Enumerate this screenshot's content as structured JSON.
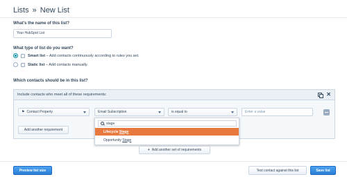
{
  "header": {
    "breadcrumb_root": "Lists",
    "separator": "»",
    "page_title": "New List"
  },
  "name_section": {
    "label": "What's the name of this list?",
    "value": "Your HubSpot List"
  },
  "type_section": {
    "label": "What type of list do you want?",
    "options": [
      {
        "name": "Smart list",
        "description": " – Add contacts continuously according to rules you set.",
        "selected": true
      },
      {
        "name": "Static list",
        "description": " – Add contacts manually.",
        "selected": false
      }
    ]
  },
  "contacts_section": {
    "label": "Which contacts should be in this list?"
  },
  "requirements": {
    "header_text": "Include contacts who meet all of these requirements:",
    "property_type": "Contact Property",
    "property": "Email Subscription",
    "operator": "is equal to",
    "value_placeholder": "Enter a value",
    "add_requirement_label": "Add another requirement"
  },
  "dropdown": {
    "search_value": "stage",
    "items": [
      {
        "prefix": "Lifecycle ",
        "match": "Stage",
        "active": true
      },
      {
        "prefix": "Opportunity ",
        "match": "Stage",
        "active": false
      }
    ]
  },
  "add_set_label": "Add another set of requirements",
  "footer": {
    "preview_label": "Preview list size",
    "test_label": "Test contact against this list",
    "save_label": "Save list"
  },
  "colors": {
    "accent": "#0091ae",
    "highlight": "#e8793e",
    "primary_button": "#2a7fd4"
  }
}
